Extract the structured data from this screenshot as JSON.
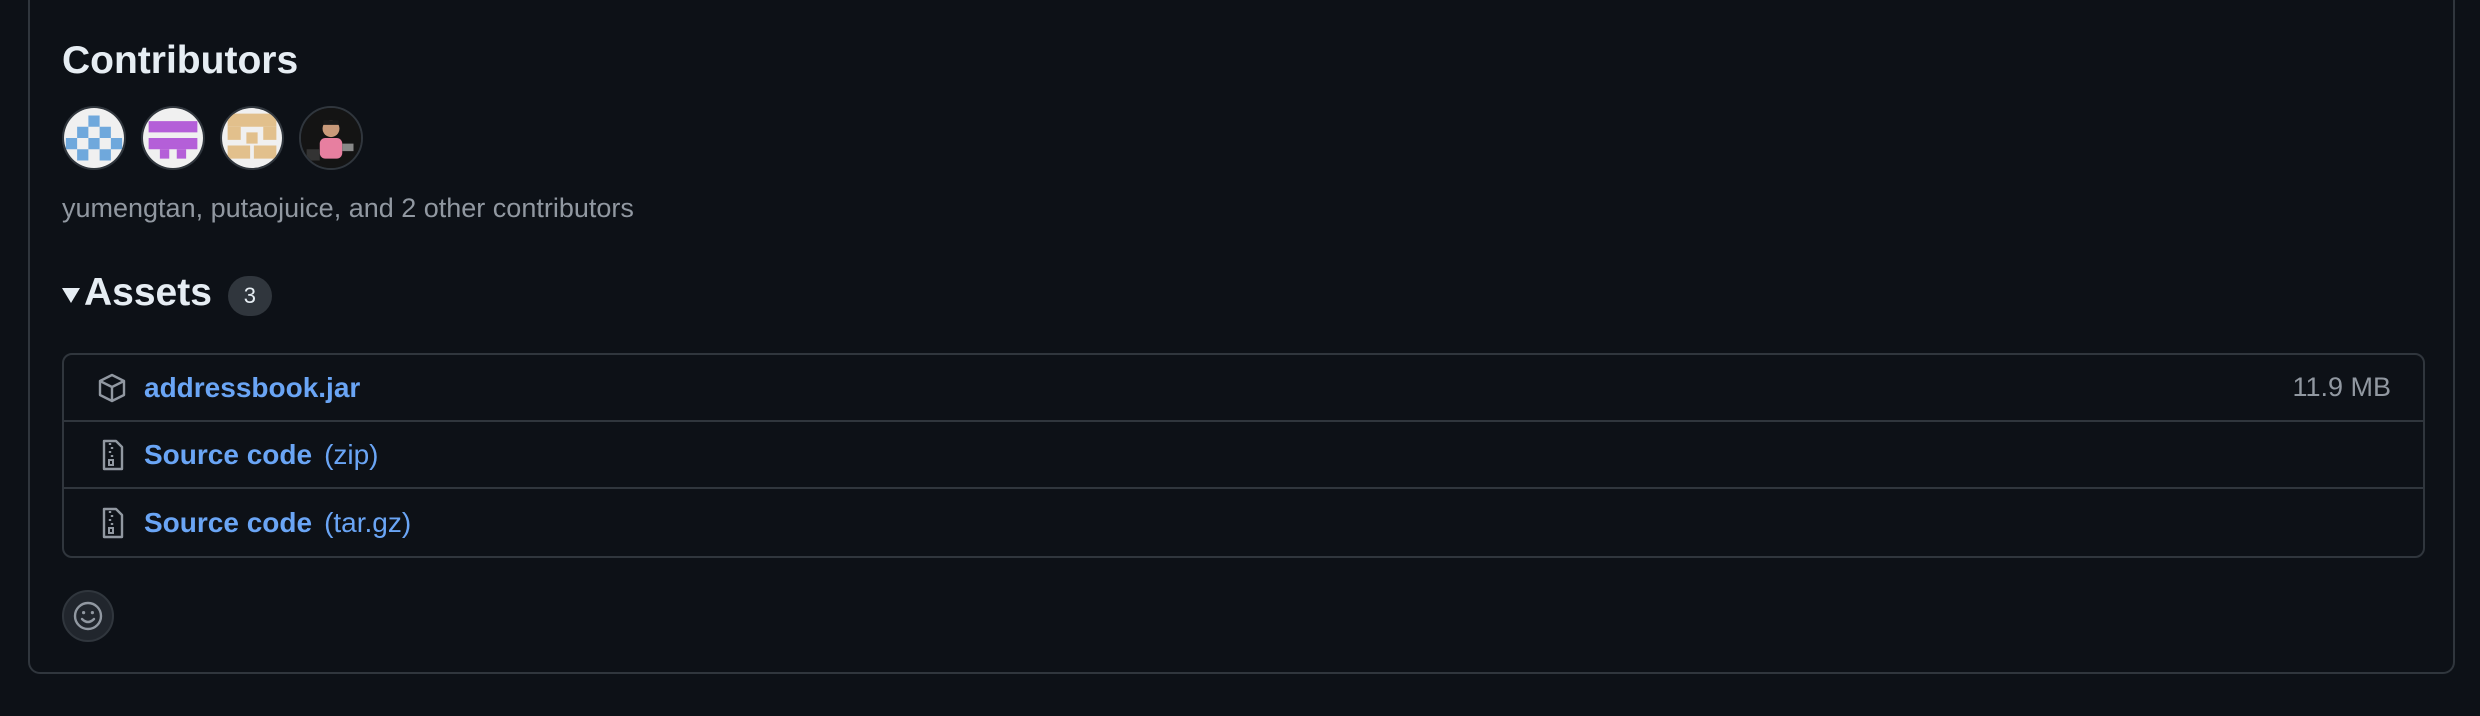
{
  "contributors": {
    "title": "Contributors",
    "summary": "yumengtan, putaojuice, and 2 other contributors",
    "avatars": [
      {
        "name": "identicon-blue",
        "color": "#6fa8dc"
      },
      {
        "name": "identicon-purple",
        "color": "#b45fd8"
      },
      {
        "name": "identicon-tan",
        "color": "#e2c08c"
      },
      {
        "name": "photo-avatar",
        "color": "#1a1a1a"
      }
    ]
  },
  "assets": {
    "title": "Assets",
    "count": "3",
    "items": [
      {
        "icon": "package-icon",
        "name": "addressbook.jar",
        "suffix": "",
        "size": "11.9 MB"
      },
      {
        "icon": "file-zip-icon",
        "name": "Source code",
        "suffix": "(zip)",
        "size": ""
      },
      {
        "icon": "file-zip-icon",
        "name": "Source code",
        "suffix": "(tar.gz)",
        "size": ""
      }
    ]
  },
  "reactions": {
    "icon": "smiley-icon"
  },
  "colors": {
    "background": "#0d1117",
    "border": "#30363d",
    "link": "#6aa5f5",
    "muted": "#9198a1",
    "text": "#e6edf3"
  }
}
